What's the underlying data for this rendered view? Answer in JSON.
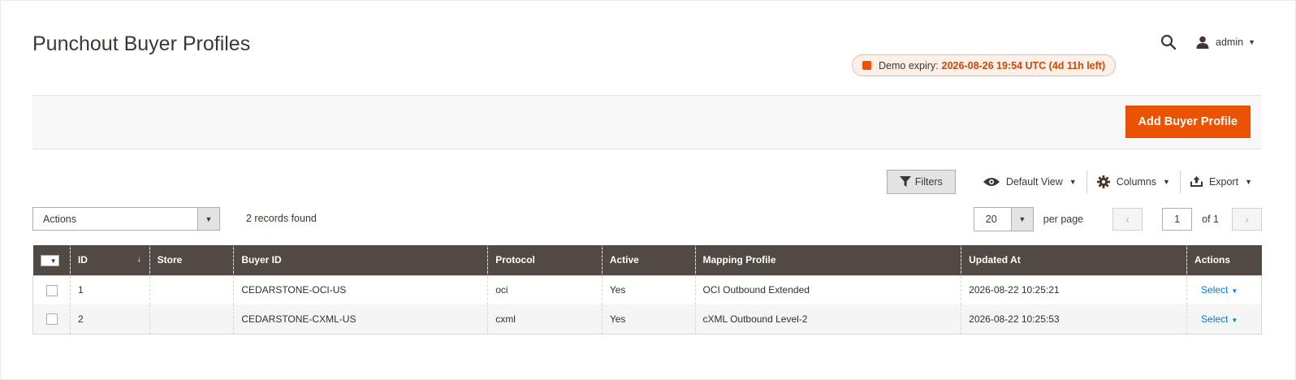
{
  "page": {
    "title": "Punchout Buyer Profiles"
  },
  "header": {
    "user_label": "admin",
    "search_icon": "search-icon",
    "user_icon": "user-icon"
  },
  "demo": {
    "label": "Demo expiry:",
    "value": "2026-08-26 19:54 UTC (4d 11h left)"
  },
  "action_bar": {
    "add_label": "Add Buyer Profile"
  },
  "toolbar": {
    "filters_label": "Filters",
    "view_label": "Default View",
    "columns_label": "Columns",
    "export_label": "Export"
  },
  "mass_actions": {
    "label": "Actions"
  },
  "records": {
    "text": "2 records found"
  },
  "pager": {
    "per_page_value": "20",
    "per_page_label": "per page",
    "current_page": "1",
    "of_label": "of 1"
  },
  "grid": {
    "columns": [
      "ID",
      "Store",
      "Buyer ID",
      "Protocol",
      "Active",
      "Mapping Profile",
      "Updated At",
      "Actions"
    ],
    "rows": [
      {
        "id": "1",
        "store": "",
        "buyer_id": "CEDARSTONE-OCI-US",
        "protocol": "oci",
        "active": "Yes",
        "mapping_profile": "OCI Outbound Extended",
        "updated_at": "2026-08-22 10:25:21",
        "action": "Select"
      },
      {
        "id": "2",
        "store": "",
        "buyer_id": "CEDARSTONE-CXML-US",
        "protocol": "cxml",
        "active": "Yes",
        "mapping_profile": "cXML Outbound Level-2",
        "updated_at": "2026-08-22 10:25:53",
        "action": "Select"
      }
    ]
  },
  "colors": {
    "accent": "#eb5202",
    "header_bg": "#514943",
    "link": "#007bdb"
  }
}
